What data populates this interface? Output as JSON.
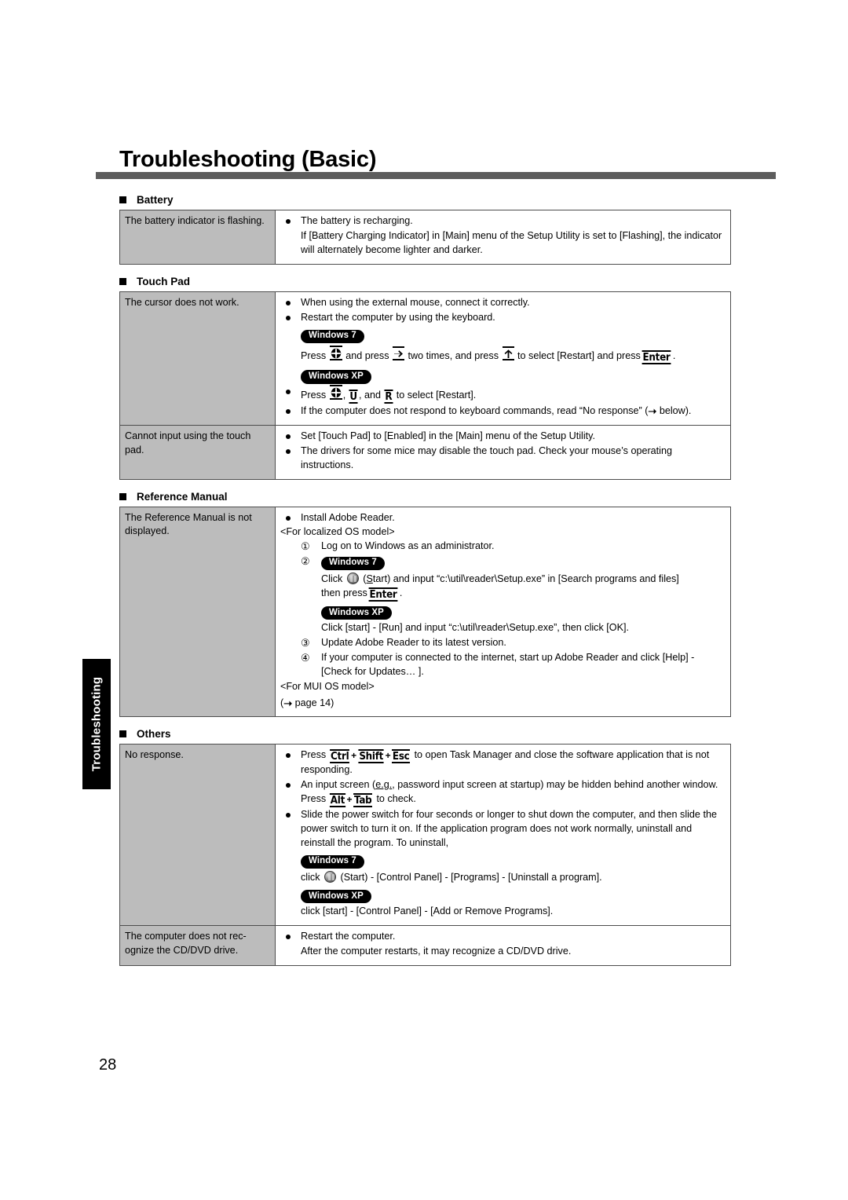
{
  "document": {
    "title": "Troubleshooting (Basic)",
    "page_number": "28",
    "side_tab_label": "Troubleshooting",
    "badges": {
      "win7": "Windows 7",
      "winxp": "Windows XP"
    },
    "keys": {
      "enter": "Enter",
      "ctrl": "Ctrl",
      "shift": "Shift",
      "esc": "Esc",
      "alt": "Alt",
      "tab": "Tab",
      "u": "U",
      "r": "R",
      "plus": "+"
    },
    "colors": {
      "rule": "#5d5d5d",
      "symptom_cell": "#bcbcbc",
      "border": "#4d4d4d",
      "badge_bg": "#000000",
      "text": "#000000"
    }
  },
  "sections": [
    {
      "heading": "Battery",
      "rows": [
        {
          "symptom": "The battery indicator is flashing.",
          "bullets": [
            "The battery is recharging.",
            "If [Battery Charging Indicator] in [Main] menu of the Setup Utility is set to [Flashing], the indicator will alternately become lighter and darker."
          ]
        }
      ]
    },
    {
      "heading": "Touch Pad",
      "rows": [
        {
          "symptom": "The cursor does not work.",
          "b1": "When using the external mouse, connect it correctly.",
          "b2": "Restart the computer by using the keyboard.",
          "win7_line_a": "Press",
          "win7_line_b": "and press",
          "win7_line_c": "two times, and press",
          "win7_line_d": "to select [Restart] and press",
          "win7_line_e": ".",
          "winxp_line_a": "Press",
          "winxp_line_b": ",",
          "winxp_line_c": ", and",
          "winxp_line_d": "to select [Restart].",
          "b3_a": "If the computer does not respond to keyboard commands, read “No response” (",
          "b3_b": "below)."
        },
        {
          "symptom": "Cannot input using the touch pad.",
          "bullets": [
            "Set [Touch Pad] to [Enabled] in the [Main] menu of the Setup Utility.",
            "The drivers for some mice may disable the touch pad. Check your mouse’s operating instructions."
          ]
        }
      ]
    },
    {
      "heading": "Reference Manual",
      "rows": [
        {
          "symptom": "The Reference Manual is not displayed.",
          "b1": "Install Adobe Reader.",
          "note_localized": "<For localized OS model>",
          "step1_num": "①",
          "step1": "Log on to Windows as an administrator.",
          "step2_num": "②",
          "step2_win7_a": "Click",
          "step2_win7_b": "(",
          "step2_win7_b_u": "S",
          "step2_win7_b2": "tart) and input “c:\\util\\reader\\Setup.exe” in [Search programs and files]",
          "step2_win7_c": "then press",
          "step2_win7_d": ".",
          "step2_winxp": "Click [start] - [Run] and input “c:\\util\\reader\\Setup.exe”, then click [OK].",
          "step3_num": "③",
          "step3": "Update Adobe Reader to its latest version.",
          "step4_num": "④",
          "step4": "If your computer is connected to the internet, start up Adobe Reader and click [Help] - [Check for Updates… ].",
          "note_mui": "<For MUI OS model>",
          "page_ref_open": "(",
          "page_ref": "page",
          "page_ref_num": "14",
          "page_ref_close": ")"
        }
      ]
    },
    {
      "heading": "Others",
      "rows": [
        {
          "symptom": "No response.",
          "b1_a": "Press",
          "b1_b": "to open Task Manager and close the software application that is not responding.",
          "b2_a": "An input screen (",
          "b2_a_u": "e.g.",
          "b2_a2": ", password input screen at startup) may be hidden behind another window. Press",
          "b2_b": "to check.",
          "b3": "Slide the power switch for four seconds or longer to shut down the computer, and then slide the power switch to turn it on. If the application program does not work normally, uninstall and reinstall the program. To uninstall,",
          "b3_win7": "click",
          "b3_win7_b": "(Start) - [Control Panel] - [Programs] - [Uninstall a program].",
          "b3_winxp": "click [start] - [Control Panel] - [Add or Remove Programs]."
        },
        {
          "symptom": "The computer does not rec- ognize the CD/DVD drive.",
          "bullets": [
            "Restart the computer.",
            "After the computer restarts, it may recognize a CD/DVD drive."
          ]
        }
      ]
    }
  ]
}
